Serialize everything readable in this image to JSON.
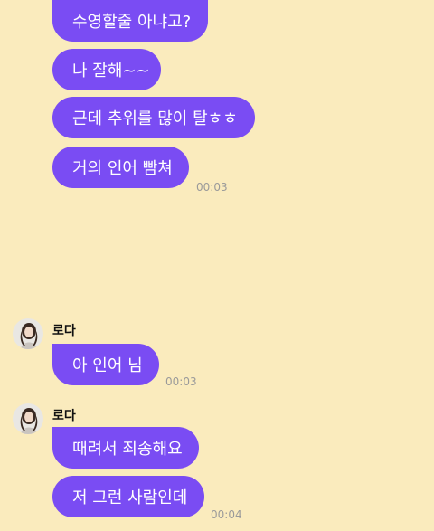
{
  "sent_group": {
    "messages": [
      "수영할줄 아냐고?",
      "나 잘해~~",
      "근데 추위를 많이 탈ㅎㅎ",
      "거의 인어 빰쳐"
    ],
    "time": "00:03"
  },
  "incoming": [
    {
      "sender": "로다",
      "messages": [
        "아 인어 님"
      ],
      "time": "00:03"
    },
    {
      "sender": "로다",
      "messages": [
        "때려서 죄송해요",
        "저 그런 사람인데"
      ],
      "time": "00:04"
    }
  ],
  "colors": {
    "background": "#FAEBBD",
    "bubble": "#7A4CF3",
    "bubble_text": "#FFFFFF",
    "time_text": "#9A9A9A"
  }
}
